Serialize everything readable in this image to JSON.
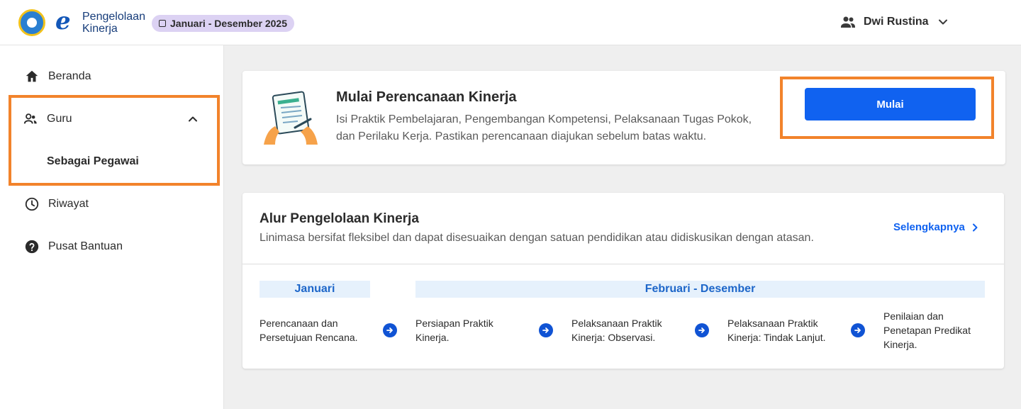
{
  "header": {
    "logo_line1": "Pengelolaan",
    "logo_line2": "Kinerja",
    "period": "Januari - Desember 2025",
    "user_name": "Dwi Rustina"
  },
  "sidebar": {
    "items": [
      {
        "label": "Beranda",
        "icon": "home-icon"
      },
      {
        "label": "Guru",
        "icon": "users-icon",
        "expanded": true,
        "children": [
          {
            "label": "Sebagai Pegawai",
            "active": true
          }
        ]
      },
      {
        "label": "Riwayat",
        "icon": "clock-icon"
      },
      {
        "label": "Pusat Bantuan",
        "icon": "help-icon"
      }
    ]
  },
  "planning_card": {
    "title": "Mulai Perencanaan Kinerja",
    "desc_line1": "Isi Praktik Pembelajaran, Pengembangan Kompetensi, Pelaksanaan Tugas Pokok,",
    "desc_line2": "dan Perilaku Kerja. Pastikan perencanaan diajukan sebelum batas waktu.",
    "button_label": "Mulai"
  },
  "flow_card": {
    "title": "Alur Pengelolaan Kinerja",
    "desc": "Linimasa bersifat fleksibel dan dapat disesuaikan dengan satuan pendidikan atau didiskusikan dengan atasan.",
    "more_link": "Selengkapnya",
    "phases": [
      "Januari",
      "Februari - Desember"
    ],
    "steps": [
      {
        "line1": "Perencanaan dan",
        "line2": "Persetujuan Rencana."
      },
      {
        "line1": "Persiapan Praktik",
        "line2": "Kinerja."
      },
      {
        "line1": "Pelaksanaan Praktik",
        "line2": "Kinerja: Observasi."
      },
      {
        "line1": "Pelaksanaan Praktik",
        "line2": "Kinerja: Tindak Lanjut."
      },
      {
        "line1": "Penilaian dan",
        "line2": "Penetapan Predikat",
        "line3": "Kinerja."
      }
    ]
  },
  "colors": {
    "primary": "#1062f0",
    "highlight": "#f2832b",
    "chip": "#dcd2f3",
    "phase_bg": "#e6f1fc"
  }
}
